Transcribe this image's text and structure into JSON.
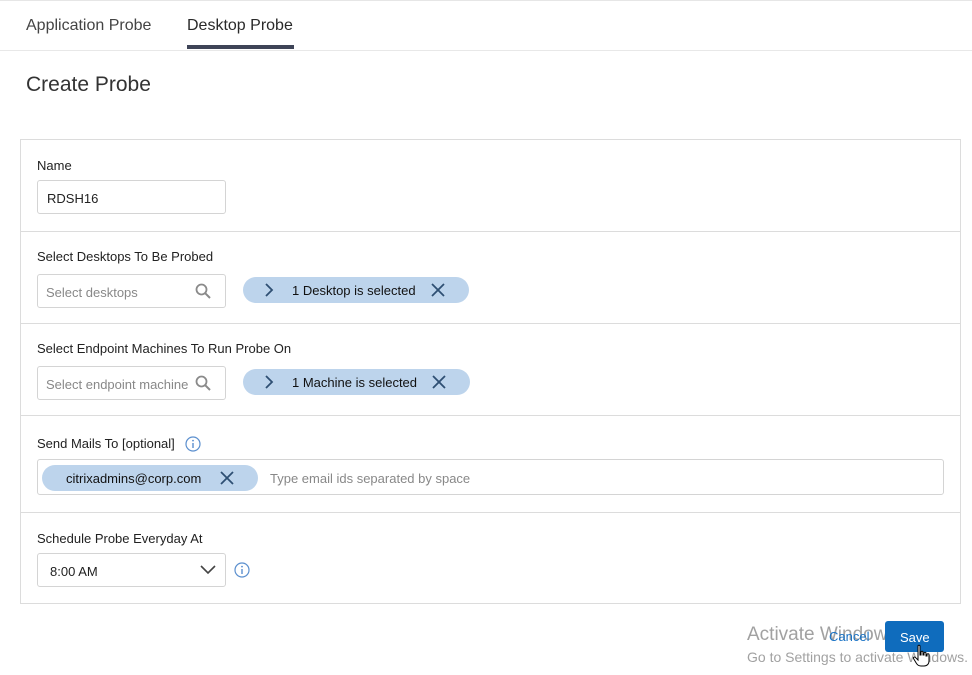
{
  "tabs": [
    {
      "label": "Application Probe"
    },
    {
      "label": "Desktop Probe"
    }
  ],
  "page_title": "Create Probe",
  "form": {
    "name": {
      "label": "Name",
      "value": "RDSH16"
    },
    "desktops": {
      "label": "Select Desktops To Be Probed",
      "placeholder": "Select desktops",
      "selected_text": "1 Desktop is selected"
    },
    "endpoints": {
      "label": "Select Endpoint Machines To Run Probe On",
      "placeholder": "Select endpoint machine",
      "selected_text": "1 Machine is selected"
    },
    "mails": {
      "label": "Send Mails To [optional]",
      "chip": "citrixadmins@corp.com",
      "placeholder": "Type email ids separated by space"
    },
    "schedule": {
      "label": "Schedule Probe Everyday At",
      "value": "8:00 AM"
    }
  },
  "buttons": {
    "cancel": "Cancel",
    "save": "Save"
  },
  "watermark": {
    "line1": "Activate Windows",
    "line2": "Go to Settings to activate Windows."
  },
  "colors": {
    "accent": "#0f6cbd",
    "chip": "#bdd4ec",
    "tab_underline": "#3e4457"
  }
}
